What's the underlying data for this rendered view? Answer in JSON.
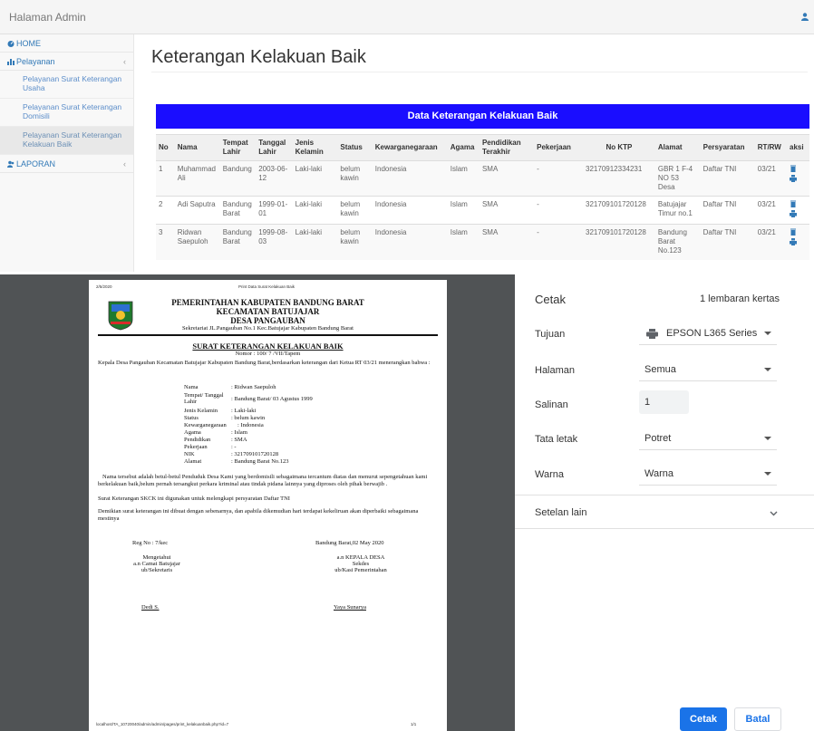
{
  "header": {
    "brand": "Halaman Admin"
  },
  "sidebar": {
    "home": "HOME",
    "pelayanan": "Pelayanan",
    "laporan": "LAPORAN",
    "chevron": "‹",
    "subs": [
      "Pelayanan Surat Keterangan Usaha",
      "Pelayanan Surat Keterangan Domisili",
      "Pelayanan Surat Keterangan Kelakuan Baik"
    ]
  },
  "main": {
    "title": "Keterangan Kelakuan Baik",
    "panel_title": "Data Keterangan Kelakuan Baik",
    "columns": [
      "No",
      "Nama",
      "Tempat Lahir",
      "Tanggal Lahir",
      "Jenis Kelamin",
      "Status",
      "Kewarganegaraan",
      "Agama",
      "Pendidikan Terakhir",
      "Pekerjaan",
      "No KTP",
      "Alamat",
      "Persyaratan",
      "RT/RW",
      "aksi"
    ],
    "rows": [
      [
        "1",
        "Muhammad Ali",
        "Bandung",
        "2003-06-12",
        "Laki-laki",
        "belum kawin",
        "Indonesia",
        "Islam",
        "SMA",
        "-",
        "32170912334231",
        "GBR 1 F-4 NO 53 Desa",
        "Daftar TNI",
        "03/21"
      ],
      [
        "2",
        "Adi Saputra",
        "Bandung Barat",
        "1999-01-01",
        "Laki-laki",
        "belum kawin",
        "Indonesia",
        "Islam",
        "SMA",
        "-",
        "321709101720128",
        "Batujajar Timur no.1",
        "Daftar TNI",
        "03/21"
      ],
      [
        "3",
        "Ridwan Saepuloh",
        "Bandung Barat",
        "1999-08-03",
        "Laki-laki",
        "belum kawin",
        "Indonesia",
        "Islam",
        "SMA",
        "-",
        "321709101720128",
        "Bandung Barat No.123",
        "Daftar TNI",
        "03/21"
      ]
    ]
  },
  "doc": {
    "date": "2/5/2020",
    "page_header": "Print Data Surat Kelakuan Baik",
    "kop1": "PEMERINTAHAN KABUPATEN BANDUNG BARAT",
    "kop2": "KECAMATAN BATUJAJAR",
    "kop3": "DESA PANGAUBAN",
    "kop4": "Sekretariat JL.Pangauban No.1 Kec.Batujajar Kabupaten Bandung Barat",
    "title": "SURAT KETERANGAN KELAKUAN BAIK",
    "nomor": "Nomor : 100/ 7 /VII/Tapem",
    "intro": "Kepala Desa Pangauban Kecamatan Batujajar Kabupaten Bandung Barat,berdasarkan keterangan dari Ketua RT 03/21 menerangkan bahwa :",
    "fields": [
      {
        "k": "Nama",
        "v": ": Ridwan Saepuloh"
      },
      {
        "k": "Tempat/ Tanggal Lahir",
        "v": ": Bandung Barat/ 03 Agustus 1999"
      },
      {
        "k": "Jenis Kelamin",
        "v": ": Laki-laki"
      },
      {
        "k": "Status",
        "v": ": belum kawin"
      },
      {
        "k": "Kewarganegaraan",
        "v": ": Indonesia"
      },
      {
        "k": "Agama",
        "v": ": Islam"
      },
      {
        "k": "Pendidikan",
        "v": ": SMA"
      },
      {
        "k": "Pekerjaan",
        "v": ": -"
      },
      {
        "k": "NIK",
        "v": ": 321709101720128"
      },
      {
        "k": "Alamat",
        "v": ": Bandung Barat No.123"
      }
    ],
    "para1": "Nama tersebut adalah betul-betul Penduduk Desa Kami yang berdomisili sebagaimana tercantum diatas dan menurut sepengetahuan kami berkelakuan baik,belum pernah tersangkut perkara kriminal atau tindak pidana lainnya yang diproses oleh pihak berwajib .",
    "para2": "Surat Keterangan SKCK ini digunakan untuk melengkapi persyaratan Daftar TNI",
    "para3": "Demikian surat keterangan ini dibuat dengan sebenarnya, dan apabila dikemudian hari terdapat kekeliruan akan diperbaiki sebagaimana mestinya",
    "reg": "Reg No : 7/kec",
    "place_date": "Bandung Barat,02 May 2020",
    "left_sign": [
      "Mengetahui",
      "a.n Camat Batujajar",
      "ub/Sekretaris"
    ],
    "right_sign": [
      "a.n KEPALA DESA",
      "Sekdes",
      "ub/Kasi Pemerintahan"
    ],
    "left_name": "Dedi S.",
    "right_name": "Yaya Sunarya",
    "footer_url": "localhost/TA_10720040/admin/admin/pages/print_kelakuanbaik.php?id=7",
    "footer_page": "1/1"
  },
  "print": {
    "title": "Cetak",
    "sheets": "1 lembaran kertas",
    "dest_label": "Tujuan",
    "dest_value": "EPSON L365 Series",
    "pages_label": "Halaman",
    "pages_value": "Semua",
    "copies_label": "Salinan",
    "copies_value": "1",
    "layout_label": "Tata letak",
    "layout_value": "Potret",
    "color_label": "Warna",
    "color_value": "Warna",
    "more_label": "Setelan lain",
    "print_btn": "Cetak",
    "cancel_btn": "Batal"
  }
}
